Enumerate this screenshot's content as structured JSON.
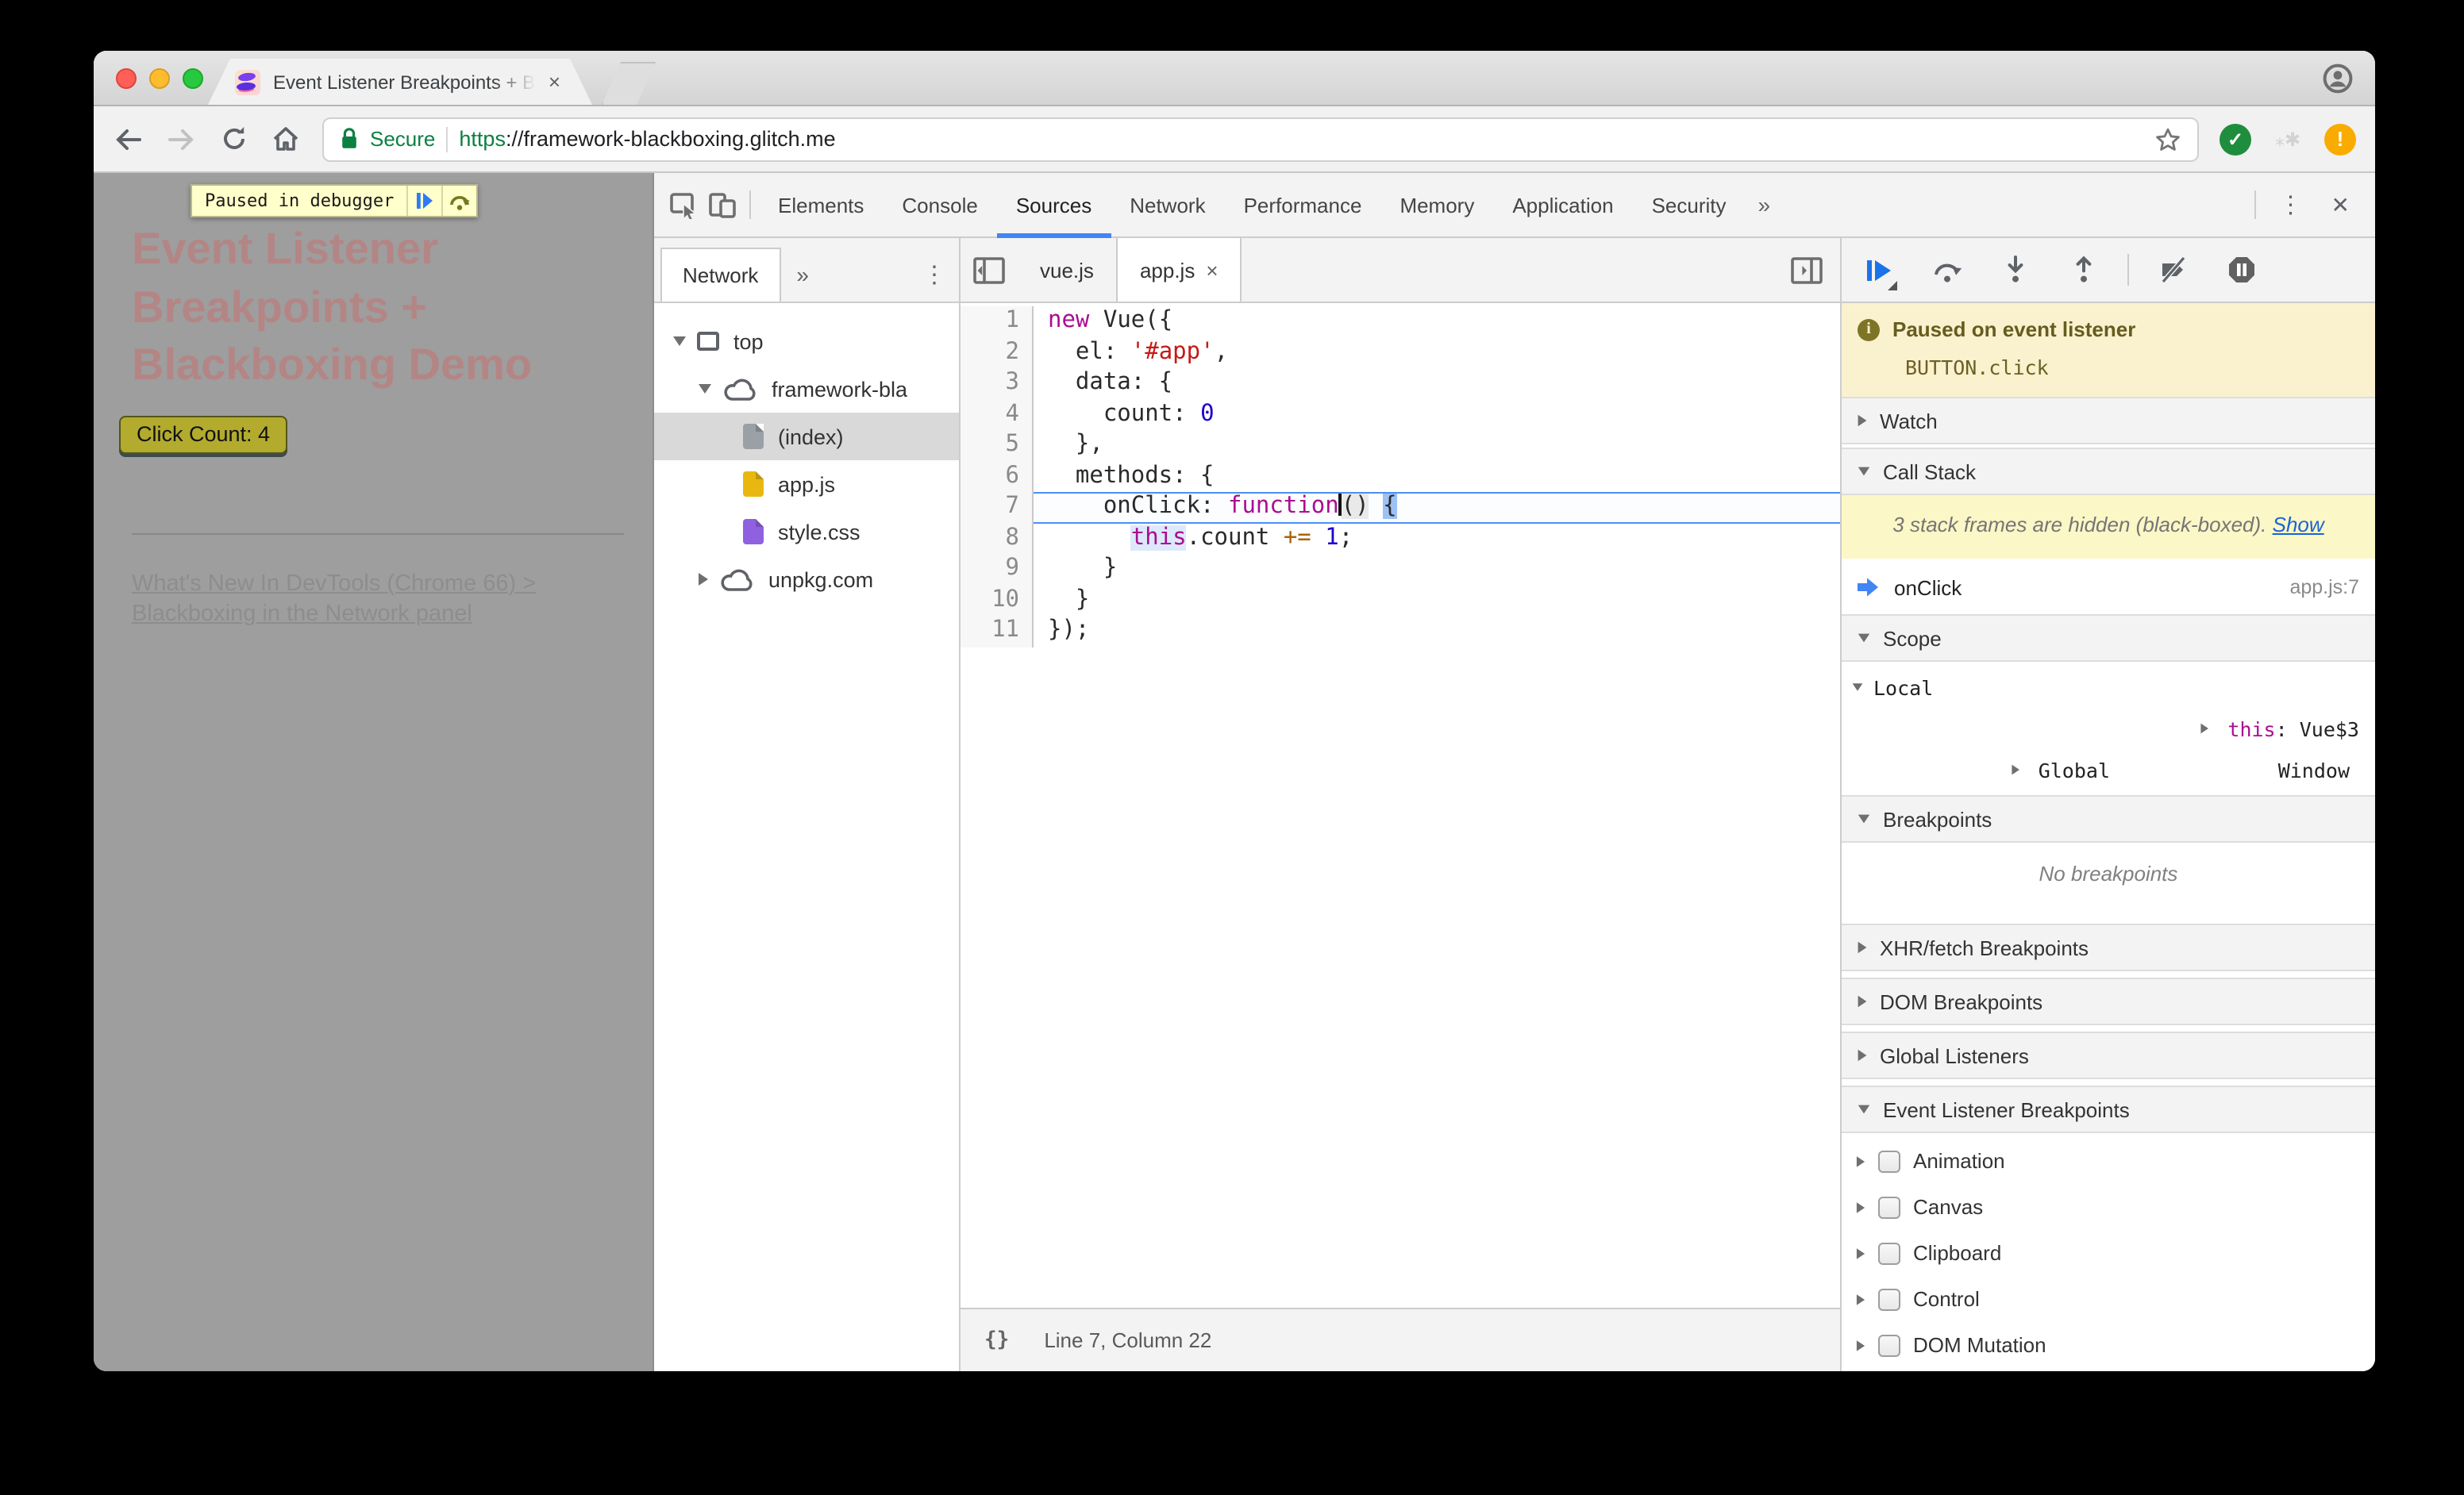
{
  "window": {
    "tab_title": "Event Listener Breakpoints + B",
    "tab_close_glyph": "×"
  },
  "browser": {
    "secure_label": "Secure",
    "url_scheme": "https",
    "url_rest": "://framework-blackboxing.glitch.me",
    "ghost_ext_glyph": "⁎✱"
  },
  "page": {
    "paused_overlay_label": "Paused in debugger",
    "heading": "Event Listener Breakpoints + Blackboxing Demo",
    "click_button_label": "Click Count: 4",
    "link_text": "What's New In DevTools (Chrome 66) > Blackboxing in the Network panel"
  },
  "devtools": {
    "main_tabs": [
      "Elements",
      "Console",
      "Sources",
      "Network",
      "Performance",
      "Memory",
      "Application",
      "Security"
    ],
    "selected_main_tab": "Sources",
    "more_tabs_glyph": "»",
    "menu_glyph": "⋮",
    "close_glyph": "✕",
    "navigator": {
      "tab_label": "Network",
      "more_glyph": "»",
      "menu_glyph": "⋮",
      "tree": [
        {
          "label": "top",
          "icon": "frame-icon",
          "level": 0,
          "disclosure": "expanded",
          "selected": false
        },
        {
          "label": "framework-bla",
          "icon": "cloud-icon",
          "level": 1,
          "disclosure": "expanded",
          "selected": false
        },
        {
          "label": "(index)",
          "icon": "document-icon",
          "icon_color": "#9aa0a6",
          "level": 2,
          "disclosure": "none",
          "selected": true
        },
        {
          "label": "app.js",
          "icon": "document-icon",
          "icon_color": "#e8b810",
          "level": 2,
          "disclosure": "none",
          "selected": false
        },
        {
          "label": "style.css",
          "icon": "document-icon",
          "icon_color": "#8f61e0",
          "level": 2,
          "disclosure": "none",
          "selected": false
        },
        {
          "label": "unpkg.com",
          "icon": "cloud-icon",
          "level": 1,
          "disclosure": "collapsed",
          "selected": false
        }
      ]
    },
    "editor": {
      "tabs": [
        {
          "label": "vue.js",
          "active": false
        },
        {
          "label": "app.js",
          "active": true,
          "close_glyph": "×"
        }
      ],
      "status_braces_glyph": "{}",
      "status_position": "Line 7, Column 22",
      "code_lines": [
        {
          "n": 1,
          "exec": false,
          "tokens": [
            {
              "t": "new",
              "c": "k"
            },
            {
              "t": " Vue({",
              "c": "d"
            }
          ]
        },
        {
          "n": 2,
          "exec": false,
          "tokens": [
            {
              "t": "  el: ",
              "c": "d"
            },
            {
              "t": "'#app'",
              "c": "s"
            },
            {
              "t": ",",
              "c": "d"
            }
          ]
        },
        {
          "n": 3,
          "exec": false,
          "tokens": [
            {
              "t": "  data: {",
              "c": "d"
            }
          ]
        },
        {
          "n": 4,
          "exec": false,
          "tokens": [
            {
              "t": "    count: ",
              "c": "d"
            },
            {
              "t": "0",
              "c": "n"
            }
          ]
        },
        {
          "n": 5,
          "exec": false,
          "tokens": [
            {
              "t": "  },",
              "c": "d"
            }
          ]
        },
        {
          "n": 6,
          "exec": false,
          "tokens": [
            {
              "t": "  methods: {",
              "c": "d"
            }
          ]
        },
        {
          "n": 7,
          "exec": true,
          "tokens": [
            {
              "t": "    onClick: ",
              "c": "d"
            },
            {
              "t": "function",
              "c": "k"
            },
            {
              "t": "",
              "c": "d",
              "cursor": true
            },
            {
              "t": "()",
              "c": "d",
              "hl": "gray"
            },
            {
              "t": " ",
              "c": "d"
            },
            {
              "t": "{",
              "c": "d",
              "hl": "blue"
            }
          ]
        },
        {
          "n": 8,
          "exec": false,
          "tokens": [
            {
              "t": "      ",
              "c": "d"
            },
            {
              "t": "this",
              "c": "k",
              "hl": "pale"
            },
            {
              "t": ".count ",
              "c": "d"
            },
            {
              "t": "+=",
              "c": "o"
            },
            {
              "t": " ",
              "c": "d"
            },
            {
              "t": "1",
              "c": "n"
            },
            {
              "t": ";",
              "c": "d"
            }
          ]
        },
        {
          "n": 9,
          "exec": false,
          "tokens": [
            {
              "t": "    }",
              "c": "d"
            }
          ]
        },
        {
          "n": 10,
          "exec": false,
          "tokens": [
            {
              "t": "  }",
              "c": "d"
            }
          ]
        },
        {
          "n": 11,
          "exec": false,
          "tokens": [
            {
              "t": "});",
              "c": "d"
            }
          ]
        }
      ]
    },
    "debugger": {
      "paused_message": "Paused on event listener",
      "paused_source": "BUTTON.click",
      "watch_label": "Watch",
      "call_stack_label": "Call Stack",
      "blackboxed_notice": "3 stack frames are hidden (black-boxed). ",
      "show_link_label": "Show",
      "stack_frame_function": "onClick",
      "stack_frame_location": "app.js:7",
      "scope_label": "Scope",
      "scope_local_label": "Local",
      "scope_this_name": "this",
      "scope_this_value": ": Vue$3",
      "scope_global_label": "Global",
      "scope_global_value": "Window",
      "breakpoints_label": "Breakpoints",
      "no_breakpoints_label": "No breakpoints",
      "xhr_label": "XHR/fetch Breakpoints",
      "dom_label": "DOM Breakpoints",
      "global_listeners_label": "Global Listeners",
      "event_listener_label": "Event Listener Breakpoints",
      "event_categories": [
        "Animation",
        "Canvas",
        "Clipboard",
        "Control",
        "DOM Mutation"
      ]
    }
  },
  "colors": {
    "accent_blue": "#4285f4",
    "exec_line_border": "#4a90f5",
    "keyword": "#aa0d91",
    "string": "#c41a16",
    "number": "#1c00cf",
    "operator": "#a8640a",
    "banner_bg": "#faf1cf",
    "banner_text": "#665c1e",
    "notice_bg": "#fbf7c6",
    "secure_green": "#0b8043",
    "heading_color": "#b48585",
    "button_bg": "#b2ab2e",
    "page_dim_bg": "#9e9e9e"
  }
}
